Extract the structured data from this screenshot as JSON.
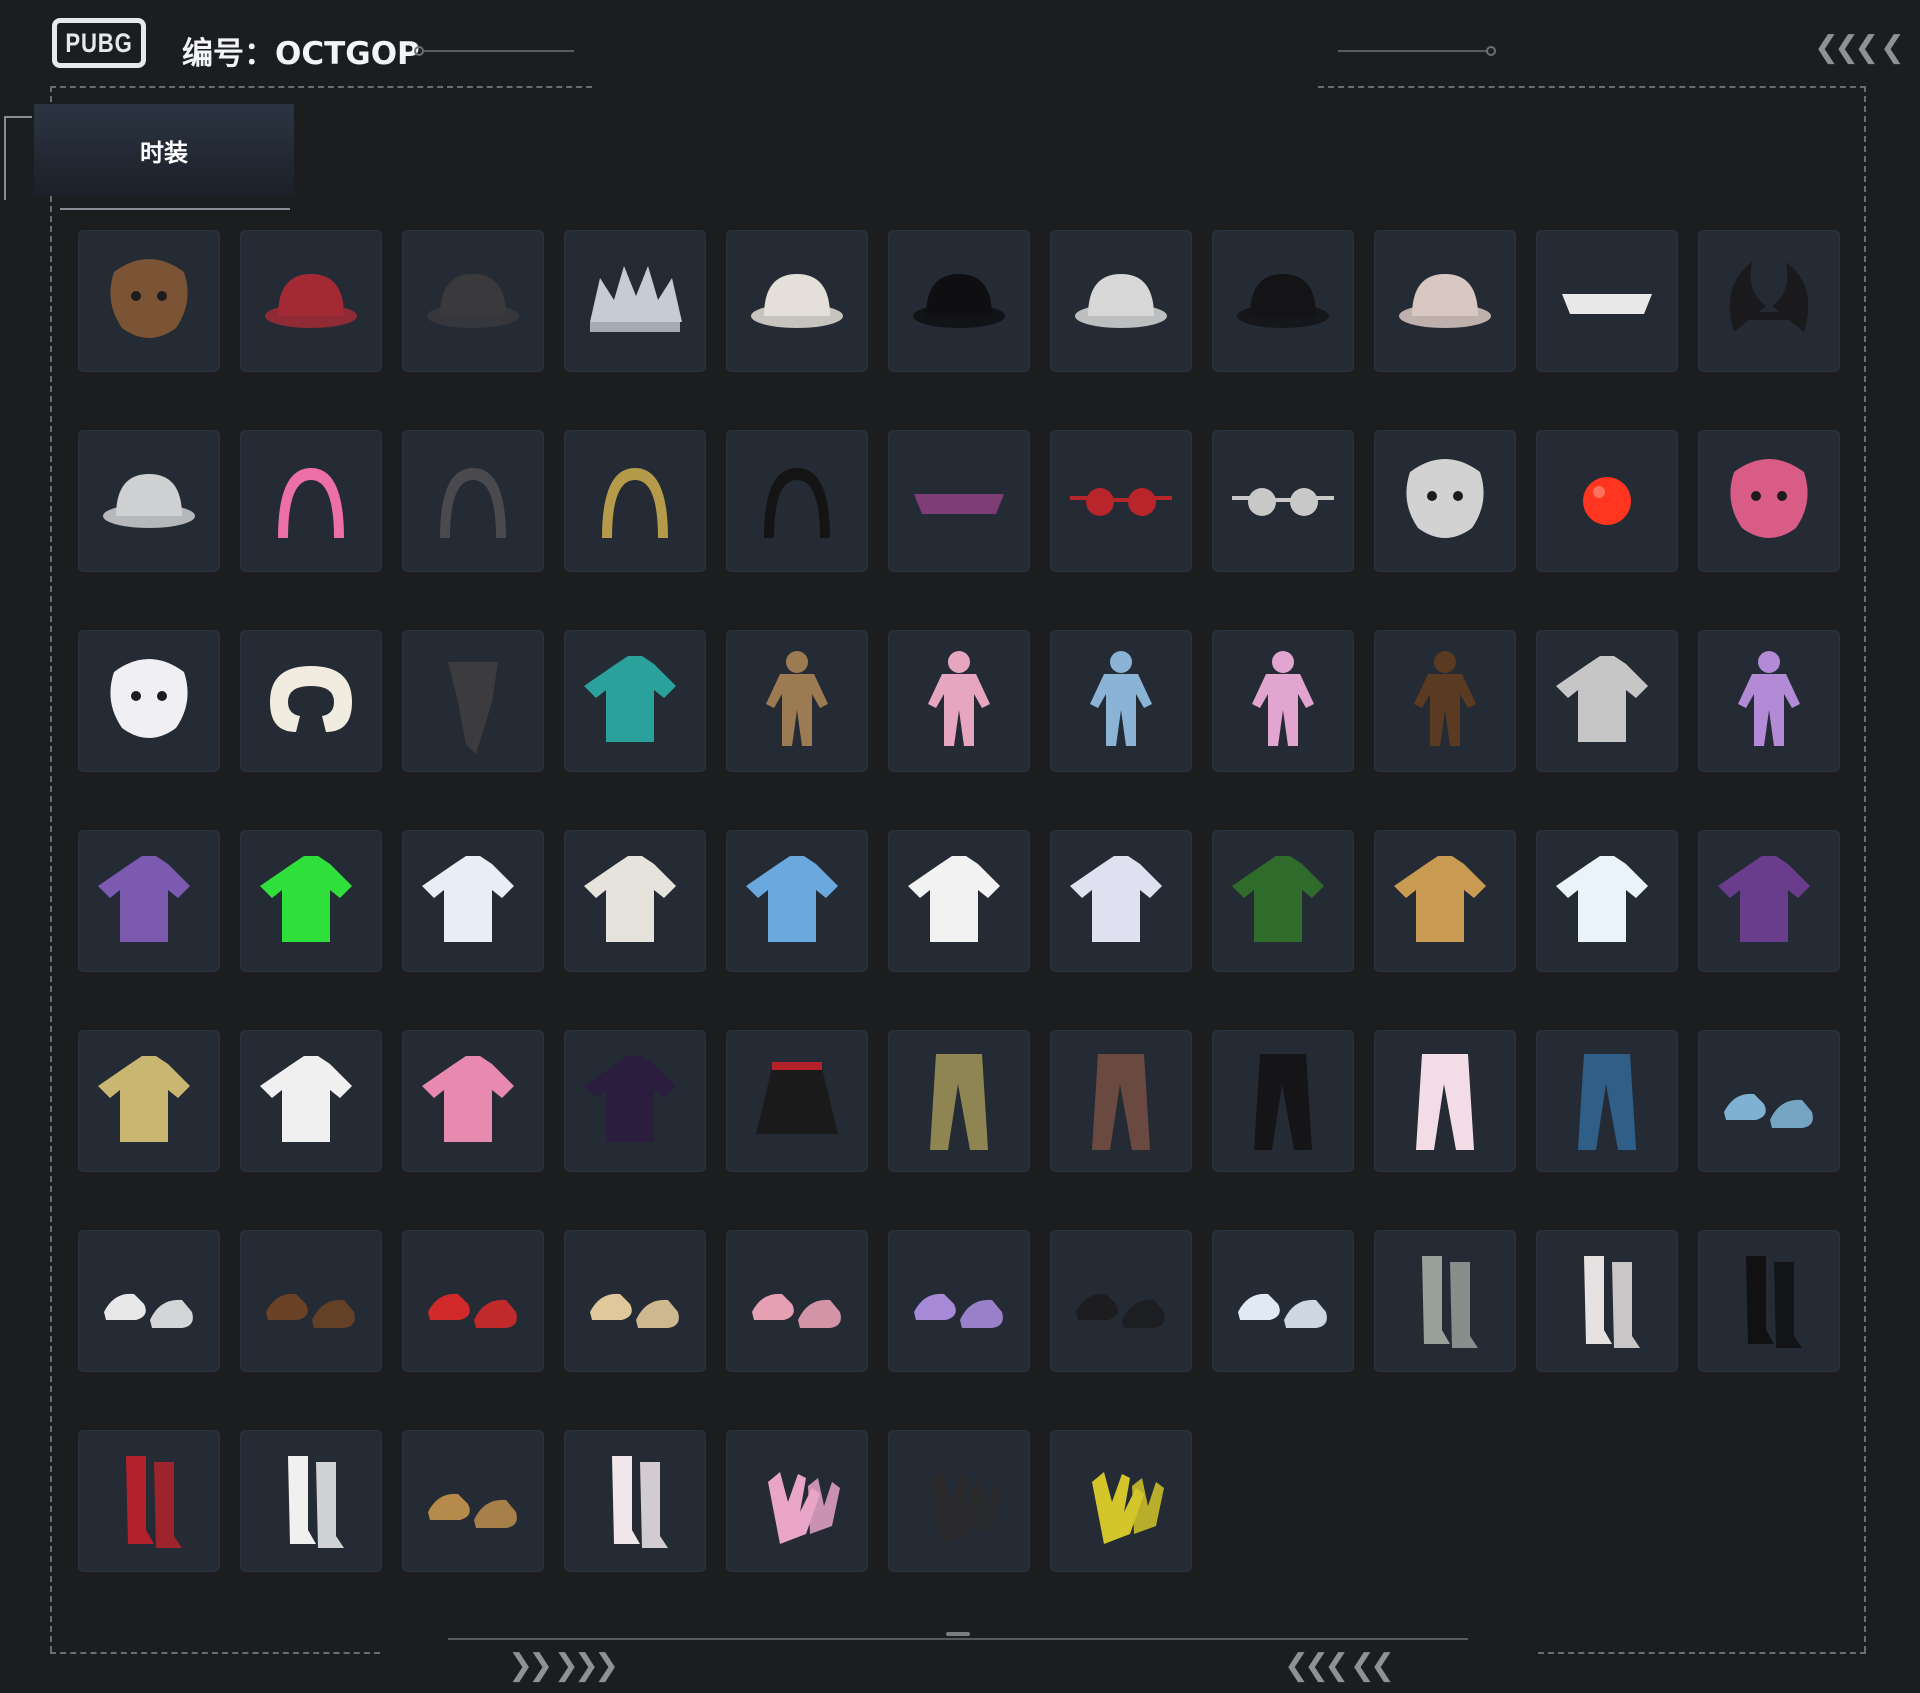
{
  "header": {
    "logo_text": "PUBG",
    "code_label": "编号：OCTGOP"
  },
  "tab": {
    "label": "时装"
  },
  "deco": {
    "chevrons_left": "❯❯ ❯❯❯",
    "chevrons_right": "❮❮❮ ❮❮",
    "chevrons_top_right": "❮❮❮ ❮"
  },
  "items": [
    {
      "icon": "bear-head-icon",
      "color": "#7a5434"
    },
    {
      "icon": "red-beret-icon",
      "color": "#a32a34"
    },
    {
      "icon": "feather-hat-icon",
      "color": "#3a3a3d"
    },
    {
      "icon": "silver-crown-icon",
      "color": "#c6ccd6"
    },
    {
      "icon": "snowman-hat-icon",
      "color": "#e4dfd8"
    },
    {
      "icon": "cat-ear-beanie-icon",
      "color": "#0f0f12"
    },
    {
      "icon": "white-cap-icon",
      "color": "#d8d8d8"
    },
    {
      "icon": "black-cap-icon",
      "color": "#141416"
    },
    {
      "icon": "horned-trapper-hat-icon",
      "color": "#d9c8c2"
    },
    {
      "icon": "checkered-visor-icon",
      "color": "#e8e8e8"
    },
    {
      "icon": "demon-horns-icon",
      "color": "#1a1a1d"
    },
    {
      "icon": "bucket-hat-icon",
      "color": "#cfd0d2"
    },
    {
      "icon": "pink-bow-headband-icon",
      "color": "#ec6fa8"
    },
    {
      "icon": "bunny-ears-headband-icon",
      "color": "#4a4a4e"
    },
    {
      "icon": "gold-cap-headphones-icon",
      "color": "#b59a4a"
    },
    {
      "icon": "panda-headband-icon",
      "color": "#141414"
    },
    {
      "icon": "purple-visor-icon",
      "color": "#7e3d74"
    },
    {
      "icon": "round-red-glasses-icon",
      "color": "#b8252a"
    },
    {
      "icon": "sunglasses-icon",
      "color": "#c8c8c8"
    },
    {
      "icon": "graffiti-mask-icon",
      "color": "#d2d2d2"
    },
    {
      "icon": "red-clown-nose-icon",
      "color": "#ff3520"
    },
    {
      "icon": "pink-animal-mask-icon",
      "color": "#d85c86"
    },
    {
      "icon": "fox-mask-icon",
      "color": "#f0f0f4"
    },
    {
      "icon": "neck-pillow-icon",
      "color": "#f1ece0"
    },
    {
      "icon": "dark-scarf-icon",
      "color": "#3c3c3f"
    },
    {
      "icon": "teal-bikini-top-icon",
      "color": "#2aa19a"
    },
    {
      "icon": "gold-bodysuit-top-icon",
      "color": "#9c7a52"
    },
    {
      "icon": "pink-onesie-icon",
      "color": "#e7a6c0"
    },
    {
      "icon": "blue-onesie-icon",
      "color": "#8ab3d6"
    },
    {
      "icon": "pink-bodysuit-icon",
      "color": "#e2a5cf"
    },
    {
      "icon": "brown-costume-icon",
      "color": "#5b3a22"
    },
    {
      "icon": "silver-jacket-icon",
      "color": "#c6c6c6"
    },
    {
      "icon": "purple-outfit-icon",
      "color": "#b28ad6"
    },
    {
      "icon": "gothic-dress-icon",
      "color": "#7b5ab0"
    },
    {
      "icon": "neon-green-top-icon",
      "color": "#2fe03a"
    },
    {
      "icon": "white-ruffle-dress-icon",
      "color": "#e8eef6"
    },
    {
      "icon": "snowman-suit-icon",
      "color": "#e6e2dc"
    },
    {
      "icon": "tie-dye-halter-icon",
      "color": "#6aa8dd"
    },
    {
      "icon": "white-crop-tee-icon",
      "color": "#f2f2f2"
    },
    {
      "icon": "white-puffer-jacket-icon",
      "color": "#dfe1f0"
    },
    {
      "icon": "green-sherpa-jacket-icon",
      "color": "#2f6b2a"
    },
    {
      "icon": "shiba-hoodie-icon",
      "color": "#c99a52"
    },
    {
      "icon": "white-fluffy-hoodie-icon",
      "color": "#eaf3fb"
    },
    {
      "icon": "purple-jacket-icon",
      "color": "#6a3d8c"
    },
    {
      "icon": "yellow-chicken-hoodie-icon",
      "color": "#c9b670"
    },
    {
      "icon": "white-graphic-tee-icon",
      "color": "#f0f0f0"
    },
    {
      "icon": "pink-anime-tee-icon",
      "color": "#e889b0"
    },
    {
      "icon": "dark-sequin-jacket-icon",
      "color": "#2b1d3d"
    },
    {
      "icon": "polka-dot-skirt-icon",
      "color": "#1a1a1a"
    },
    {
      "icon": "gold-cargo-pants-icon",
      "color": "#8f8553"
    },
    {
      "icon": "plaid-pants-icon",
      "color": "#6a4a40"
    },
    {
      "icon": "black-pants-icon",
      "color": "#151518"
    },
    {
      "icon": "pink-sweatpants-icon",
      "color": "#f2dce6"
    },
    {
      "icon": "blue-patch-jeans-icon",
      "color": "#2f5f86"
    },
    {
      "icon": "shark-slippers-icon",
      "color": "#7fb1d3"
    },
    {
      "icon": "white-sneakers-icon",
      "color": "#e8e8e8"
    },
    {
      "icon": "bear-paw-shoes-icon",
      "color": "#6b4226"
    },
    {
      "icon": "red-white-boots-icon",
      "color": "#d22a2a"
    },
    {
      "icon": "tan-sneakers-icon",
      "color": "#e0c89a"
    },
    {
      "icon": "pink-shark-slippers-icon",
      "color": "#e6a0b4"
    },
    {
      "icon": "purple-platform-boots-icon",
      "color": "#a68ad8"
    },
    {
      "icon": "black-furry-boots-icon",
      "color": "#1d1d1f"
    },
    {
      "icon": "white-fluffy-boots-icon",
      "color": "#dfeaf4"
    },
    {
      "icon": "silver-sock-sneakers-icon",
      "color": "#9aa09a"
    },
    {
      "icon": "white-tall-boots-icon",
      "color": "#e6e2e2"
    },
    {
      "icon": "black-thigh-boots-icon",
      "color": "#111113"
    },
    {
      "icon": "red-sock-boots-icon",
      "color": "#b3222b"
    },
    {
      "icon": "white-socks-red-shoes-icon",
      "color": "#f0f0f0"
    },
    {
      "icon": "tan-work-boots-icon",
      "color": "#b58a4a"
    },
    {
      "icon": "white-stockings-icon",
      "color": "#f1e7ea"
    },
    {
      "icon": "pink-gloves-icon",
      "color": "#e8a5c8"
    },
    {
      "icon": "black-leather-gloves-icon",
      "color": "#2a2a2c"
    },
    {
      "icon": "cyber-yellow-gloves-icon",
      "color": "#d4c62a"
    }
  ]
}
